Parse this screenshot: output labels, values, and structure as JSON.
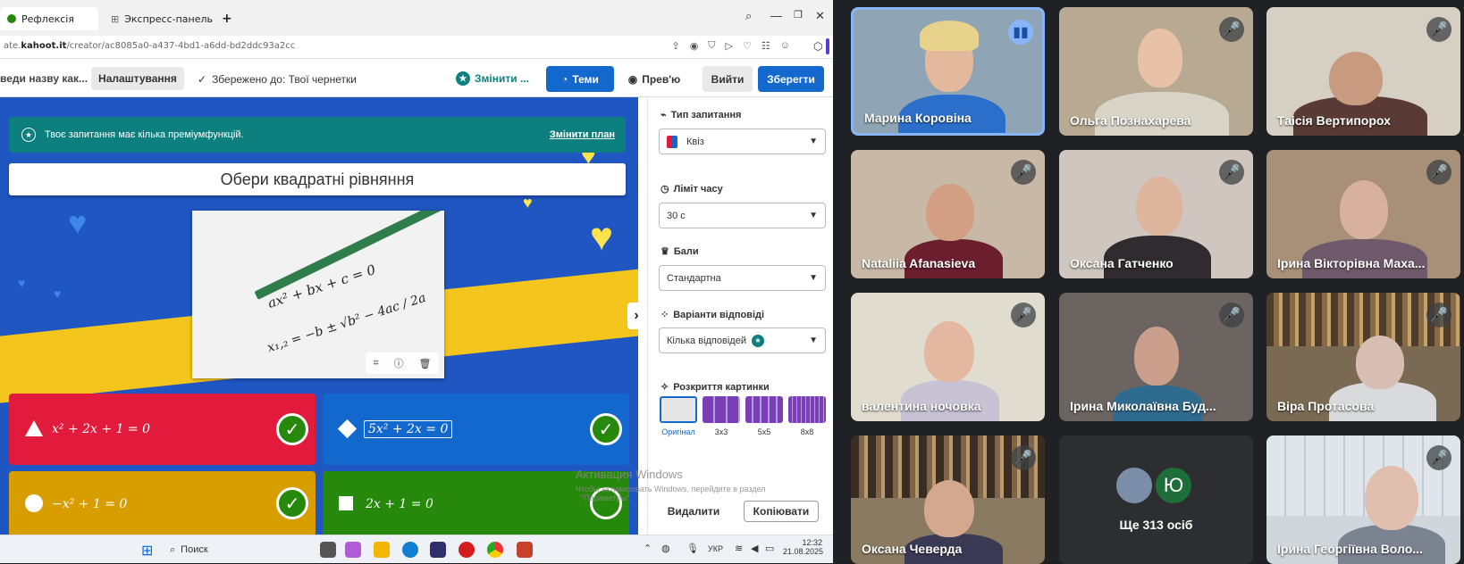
{
  "browser": {
    "tabs": [
      {
        "label": "Рефлексія",
        "active": true
      },
      {
        "label": "Экспресс-панель",
        "active": false
      }
    ],
    "new_tab": "+",
    "window_controls": [
      "search-icon",
      "minimize",
      "snap",
      "close"
    ],
    "url_prefix": "ate.",
    "url_domain": "kahoot.it",
    "url_path": "/creator/ac8085a0-a437-4bd1-a6dd-bd2ddc93a2cc"
  },
  "toolbar": {
    "title_input": "веди назву как...",
    "settings_label": "Налаштування",
    "saved_status": "Збережено до: Твої чернетки",
    "change_plan_label": "Змінити ...",
    "themes_label": "Теми",
    "preview_label": "Прев'ю",
    "exit_label": "Вийти",
    "save_label": "Зберегти"
  },
  "editor": {
    "premium_banner": "Твоє запитання має кілька преміумфункцій.",
    "change_plan_link": "Змінити план",
    "question": "Обери квадратні рівняння",
    "image_formula_1": "ax² + bx + c = 0",
    "image_formula_2": "x₁,₂ = −b ± √b² − 4ac / 2a",
    "answers": [
      {
        "text": "x² + 2x + 1 = 0",
        "color": "#e21b3c",
        "shape": "triangle",
        "correct": true
      },
      {
        "text": "5x² + 2x = 0",
        "color": "#1368ce",
        "shape": "diamond",
        "correct": true
      },
      {
        "text": "−x² + 1 = 0",
        "color": "#d89e00",
        "shape": "circle",
        "correct": true
      },
      {
        "text": "2x + 1 = 0",
        "color": "#26890c",
        "shape": "square",
        "correct": false
      }
    ]
  },
  "sidebar": {
    "question_type_label": "Тип запитання",
    "question_type_value": "Квіз",
    "time_limit_label": "Ліміт часу",
    "time_limit_value": "30 с",
    "points_label": "Бали",
    "points_value": "Стандартна",
    "answer_options_label": "Варіанти відповіді",
    "answer_options_value": "Кілька відповідей",
    "image_reveal_label": "Розкриття картинки",
    "reveal_options": [
      "Оригінал",
      "3x3",
      "5x5",
      "8x8"
    ],
    "delete_label": "Видалити",
    "copy_label": "Копіювати"
  },
  "windows_watermark": {
    "title": "Активация Windows",
    "line1": "Чтобы активировать Windows, перейдите в раздел",
    "line2": "\"Параметры\"."
  },
  "taskbar": {
    "search_placeholder": "Поиск",
    "lang": "УКР",
    "time": "12:32",
    "date": "21.08.2025"
  },
  "meet": {
    "participants": [
      {
        "name": "Марина Коровіна",
        "speaking": true
      },
      {
        "name": "Ольга Познахарева",
        "speaking": false
      },
      {
        "name": "Таісія Вертипорох",
        "speaking": false
      },
      {
        "name": "Nataliia Afanasieva",
        "speaking": false
      },
      {
        "name": "Оксана Гатченко",
        "speaking": false
      },
      {
        "name": "Ірина Вікторівна Маха...",
        "speaking": false
      },
      {
        "name": "валентина ночовка",
        "speaking": false
      },
      {
        "name": "Ірина Миколаївна Буд...",
        "speaking": false
      },
      {
        "name": "Віра Протасова",
        "speaking": false
      },
      {
        "name": "Оксана Чеверда",
        "speaking": false
      },
      {
        "name": "Ірина Георгіївна Воло...",
        "speaking": false
      }
    ],
    "more_avatar_letter": "Ю",
    "more_label": "Ще 313 осіб",
    "colors": {
      "speaking_border": "#8ab4f8",
      "tile_bg": "#3c4043",
      "avatar_green": "#1e6e3a"
    }
  }
}
